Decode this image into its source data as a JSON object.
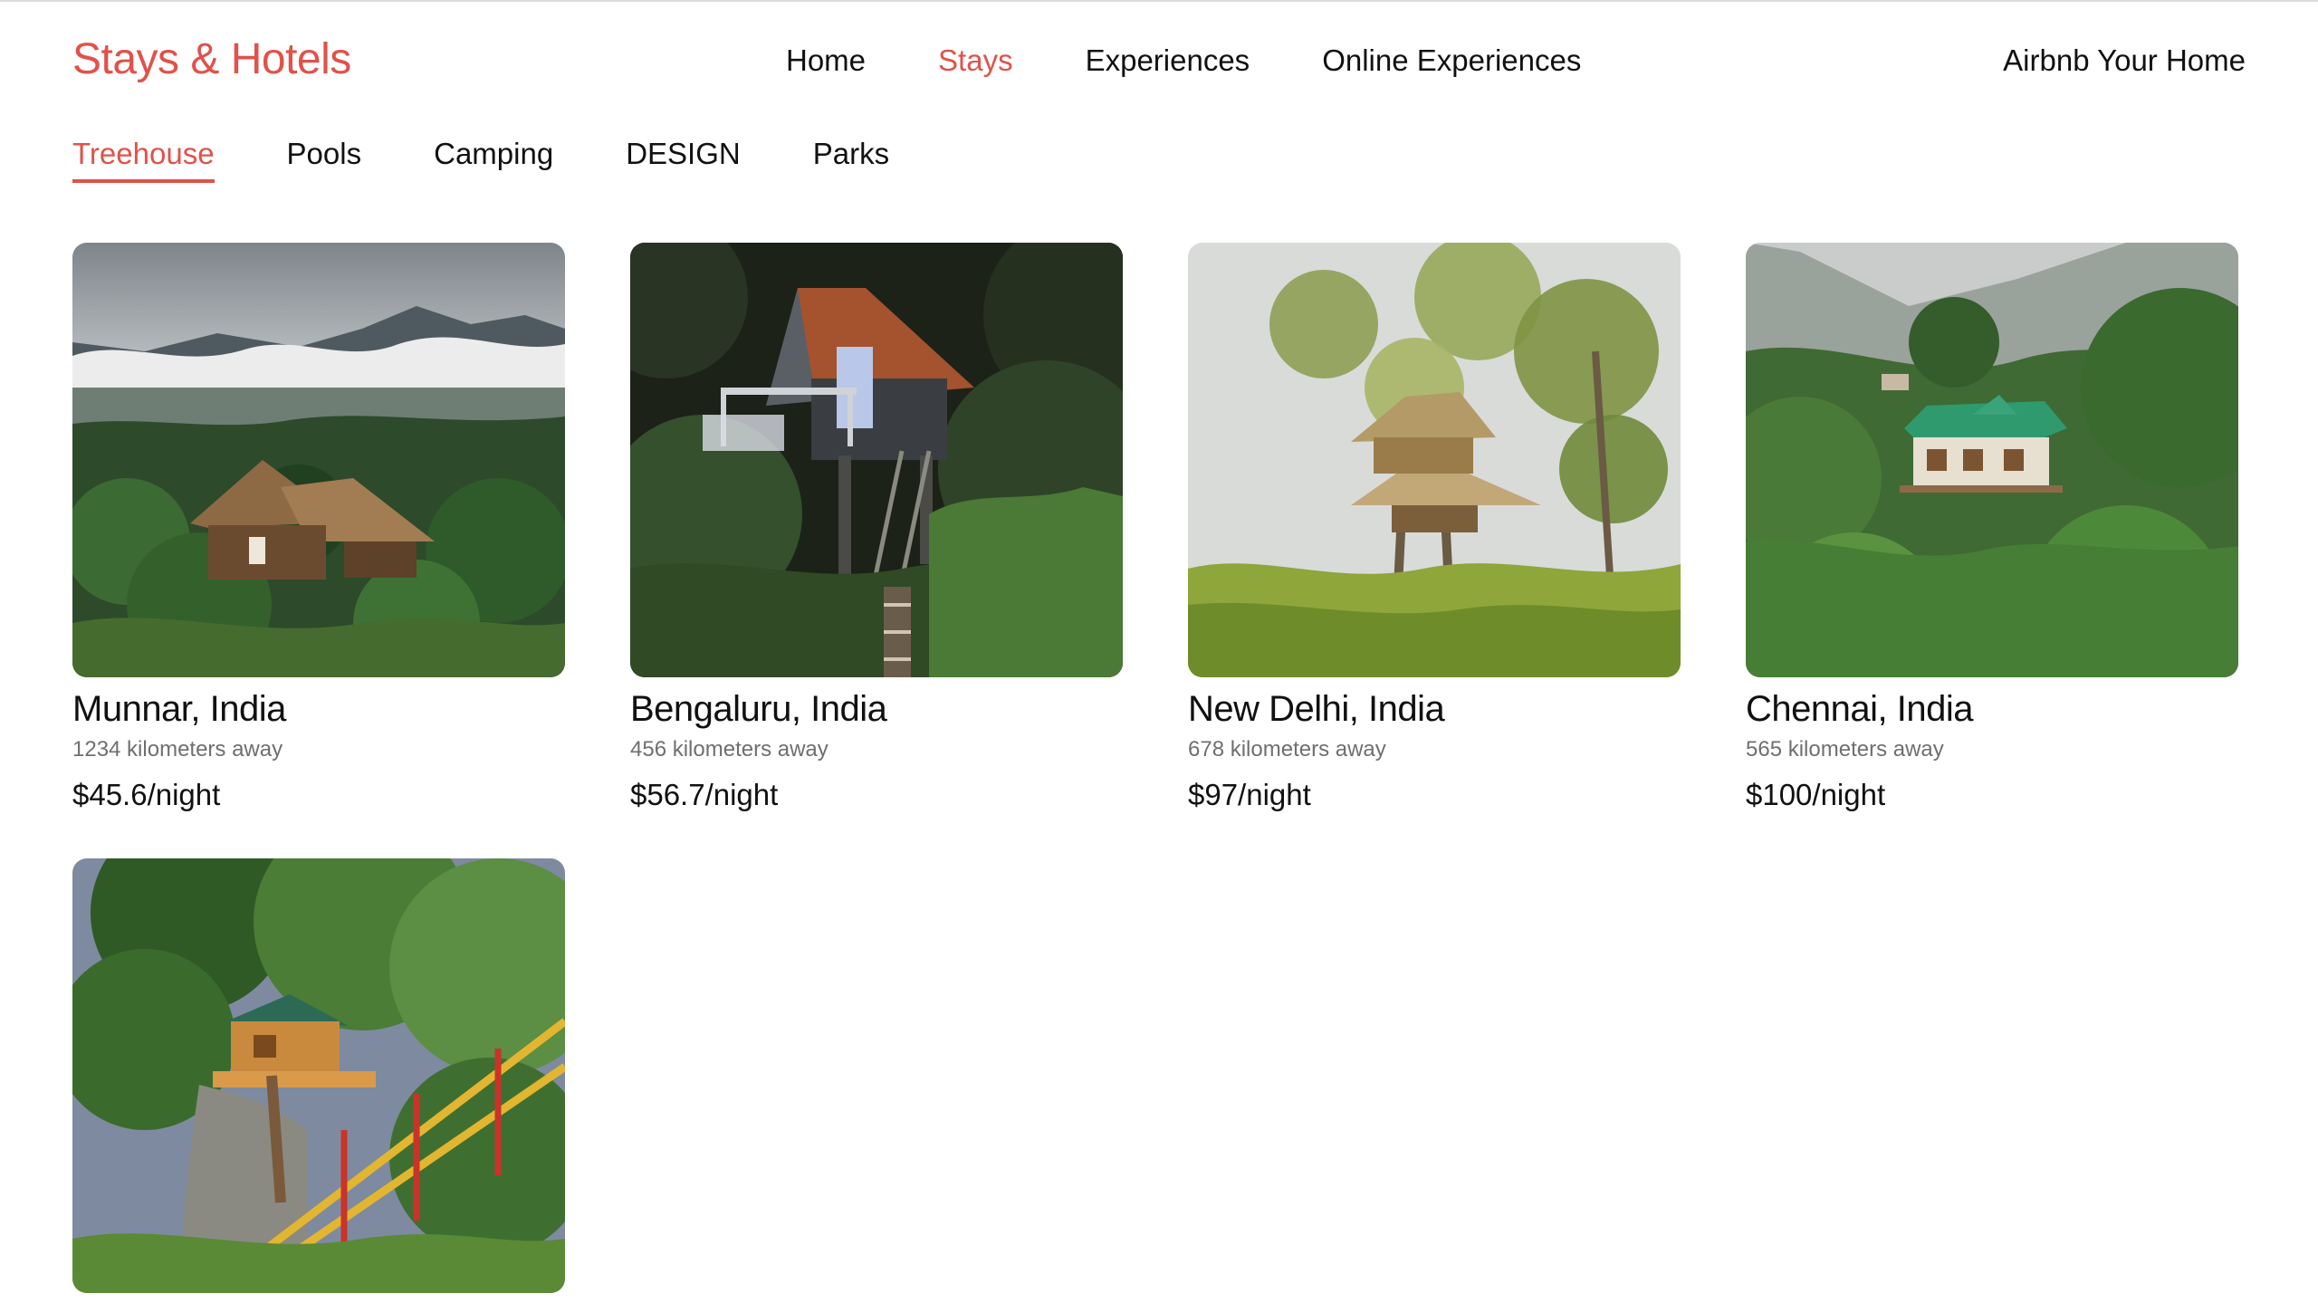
{
  "brand": {
    "title": "Stays & Hotels"
  },
  "main_nav": {
    "items": [
      {
        "label": "Home",
        "active": false
      },
      {
        "label": "Stays",
        "active": true
      },
      {
        "label": "Experiences",
        "active": false
      },
      {
        "label": "Online Experiences",
        "active": false
      }
    ],
    "host_link": "Airbnb Your Home"
  },
  "category_tabs": [
    {
      "label": "Treehouse",
      "active": true
    },
    {
      "label": "Pools",
      "active": false
    },
    {
      "label": "Camping",
      "active": false
    },
    {
      "label": "DESIGN",
      "active": false
    },
    {
      "label": "Parks",
      "active": false
    }
  ],
  "listings": [
    {
      "title": "Munnar, India",
      "distance": "1234 kilometers away",
      "price": "$45.6/night",
      "image": "thatched-hut-in-misty-hills-photo"
    },
    {
      "title": "Bengaluru, India",
      "distance": "456 kilometers away",
      "price": "$56.7/night",
      "image": "a-frame-cabin-in-jungle-photo"
    },
    {
      "title": "New Delhi, India",
      "distance": "678 kilometers away",
      "price": "$97/night",
      "image": "thatched-treehouse-in-field-photo"
    },
    {
      "title": "Chennai, India",
      "distance": "565 kilometers away",
      "price": "$100/night",
      "image": "green-roof-house-in-valley-photo"
    },
    {
      "image": "wooden-treehouse-on-rock-photo"
    }
  ],
  "colors": {
    "accent": "#e0524a",
    "text": "#111111",
    "muted": "#6f6f6f"
  }
}
